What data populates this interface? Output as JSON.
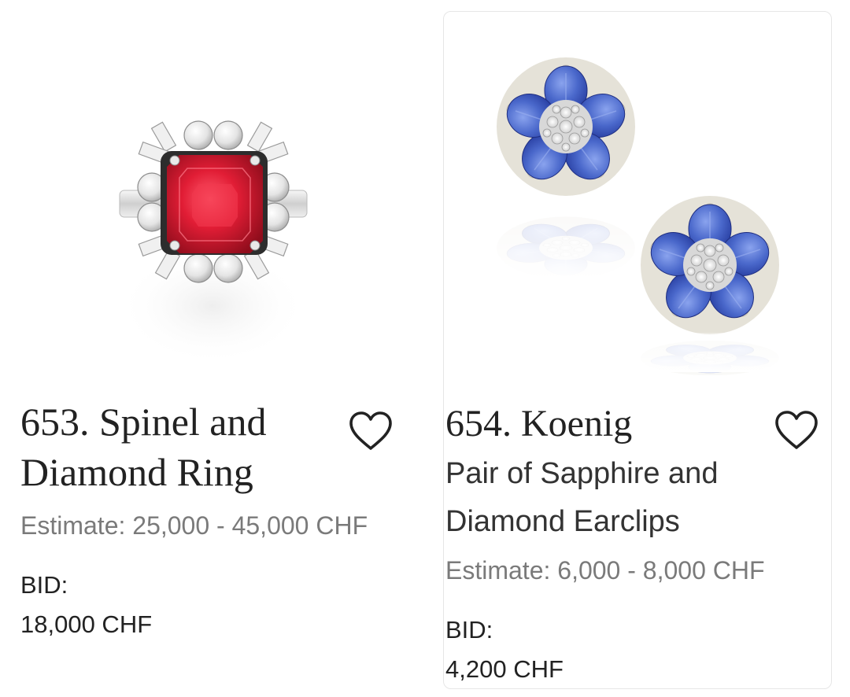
{
  "lots": [
    {
      "title": "653. Spinel and Diamond Ring",
      "subtitle": "",
      "estimate": "Estimate: 25,000 - 45,000 CHF",
      "bid_label": "BID:",
      "bid_value": "18,000 CHF",
      "favorite_icon": "heart-outline-icon",
      "image": "spinel-diamond-ring"
    },
    {
      "title": "654. Koenig",
      "subtitle": "Pair of Sapphire and Diamond Earclips",
      "estimate": "Estimate: 6,000 - 8,000 CHF",
      "bid_label": "BID:",
      "bid_value": "4,200 CHF",
      "favorite_icon": "heart-outline-icon",
      "image": "sapphire-diamond-earclips"
    }
  ],
  "colors": {
    "text": "#222222",
    "muted_text": "#7a7a7a",
    "card_border": "#e6e6e6",
    "spinel": "#d7192f",
    "sapphire": "#4867c8"
  }
}
